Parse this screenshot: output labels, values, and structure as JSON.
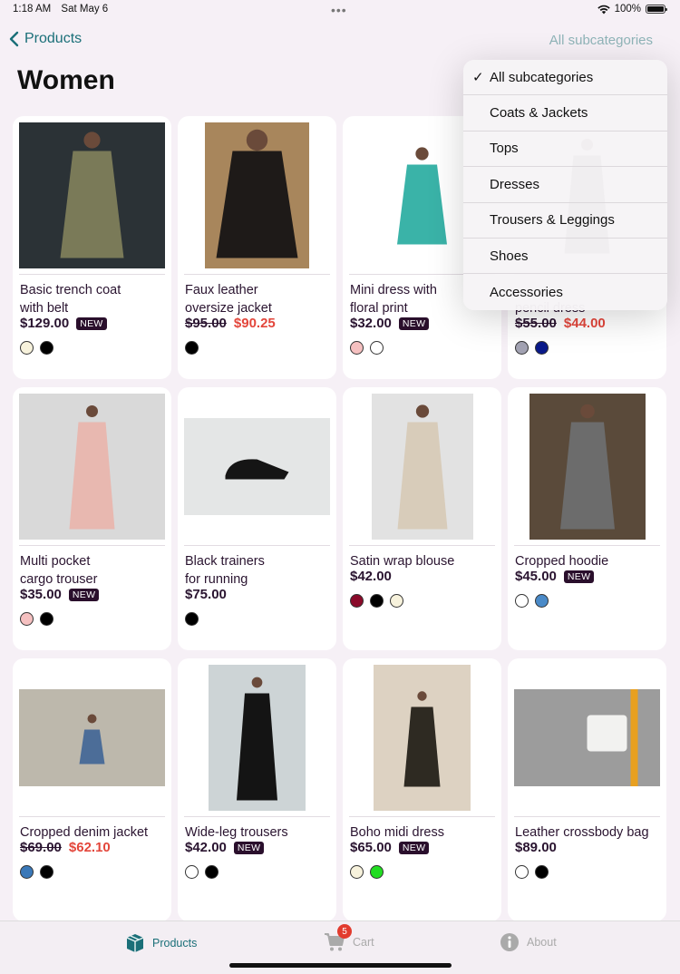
{
  "status": {
    "time": "1:18 AM",
    "date": "Sat May 6",
    "battery": "100%"
  },
  "nav": {
    "back_label": "Products",
    "subcategory_label": "All subcategories"
  },
  "page": {
    "title": "Women"
  },
  "dropdown": {
    "selected": "All subcategories",
    "items": [
      {
        "label": "All subcategories"
      },
      {
        "label": "Coats & Jackets"
      },
      {
        "label": "Tops"
      },
      {
        "label": "Dresses"
      },
      {
        "label": "Trousers & Leggings"
      },
      {
        "label": "Shoes"
      },
      {
        "label": "Accessories"
      }
    ]
  },
  "products": [
    {
      "name": "Basic trench coat\nwith belt",
      "price": "$129.00",
      "old_price": "",
      "sale_price": "",
      "badge": "NEW",
      "colors": [
        "#f7f2dc",
        "#000000"
      ],
      "image_icon": "trench-coat-photo"
    },
    {
      "name": "Faux leather\noversize jacket",
      "price": "",
      "old_price": "$95.00",
      "sale_price": "$90.25",
      "badge": "",
      "colors": [
        "#000000"
      ],
      "image_icon": "leather-jacket-photo"
    },
    {
      "name": "Mini dress with\nfloral print",
      "price": "$32.00",
      "old_price": "",
      "sale_price": "",
      "badge": "NEW",
      "colors": [
        "#f5c0c0",
        "#ffffff"
      ],
      "image_icon": "floral-dress-photo"
    },
    {
      "name": "\npencil dress",
      "price": "",
      "old_price": "$55.00",
      "sale_price": "$44.00",
      "badge": "",
      "colors": [
        "#a3a3b3",
        "#0a1a8a"
      ],
      "image_icon": "pencil-dress-photo"
    },
    {
      "name": "Multi pocket\ncargo trouser",
      "price": "$35.00",
      "old_price": "",
      "sale_price": "",
      "badge": "NEW",
      "colors": [
        "#f5c0c0",
        "#000000"
      ],
      "image_icon": "cargo-trouser-photo"
    },
    {
      "name": "Black trainers\nfor running",
      "price": "$75.00",
      "old_price": "",
      "sale_price": "",
      "badge": "",
      "colors": [
        "#000000"
      ],
      "image_icon": "trainers-photo"
    },
    {
      "name": "Satin wrap blouse",
      "price": "$42.00",
      "old_price": "",
      "sale_price": "",
      "badge": "",
      "colors": [
        "#8a0a2a",
        "#000000",
        "#f7f2dc"
      ],
      "image_icon": "satin-blouse-photo"
    },
    {
      "name": "Cropped hoodie",
      "price": "$45.00",
      "old_price": "",
      "sale_price": "",
      "badge": "NEW",
      "colors": [
        "#ffffff",
        "#4a8ac8"
      ],
      "image_icon": "hoodie-photo"
    },
    {
      "name": "Cropped denim jacket",
      "price": "",
      "old_price": "$69.00",
      "sale_price": "$62.10",
      "badge": "",
      "colors": [
        "#3a78b8",
        "#000000"
      ],
      "image_icon": "denim-jacket-photo"
    },
    {
      "name": "Wide-leg trousers",
      "price": "$42.00",
      "old_price": "",
      "sale_price": "",
      "badge": "NEW",
      "colors": [
        "#ffffff",
        "#000000"
      ],
      "image_icon": "wide-leg-trousers-photo"
    },
    {
      "name": "Boho midi dress",
      "price": "$65.00",
      "old_price": "",
      "sale_price": "",
      "badge": "NEW",
      "colors": [
        "#f7f2dc",
        "#22dd22"
      ],
      "image_icon": "boho-dress-photo"
    },
    {
      "name": "Leather crossbody bag",
      "price": "$89.00",
      "old_price": "",
      "sale_price": "",
      "badge": "",
      "colors": [
        "#ffffff",
        "#000000"
      ],
      "image_icon": "crossbody-bag-photo"
    }
  ],
  "tabbar": {
    "products_label": "Products",
    "cart_label": "Cart",
    "cart_count": "5",
    "about_label": "About",
    "active": "Products"
  }
}
